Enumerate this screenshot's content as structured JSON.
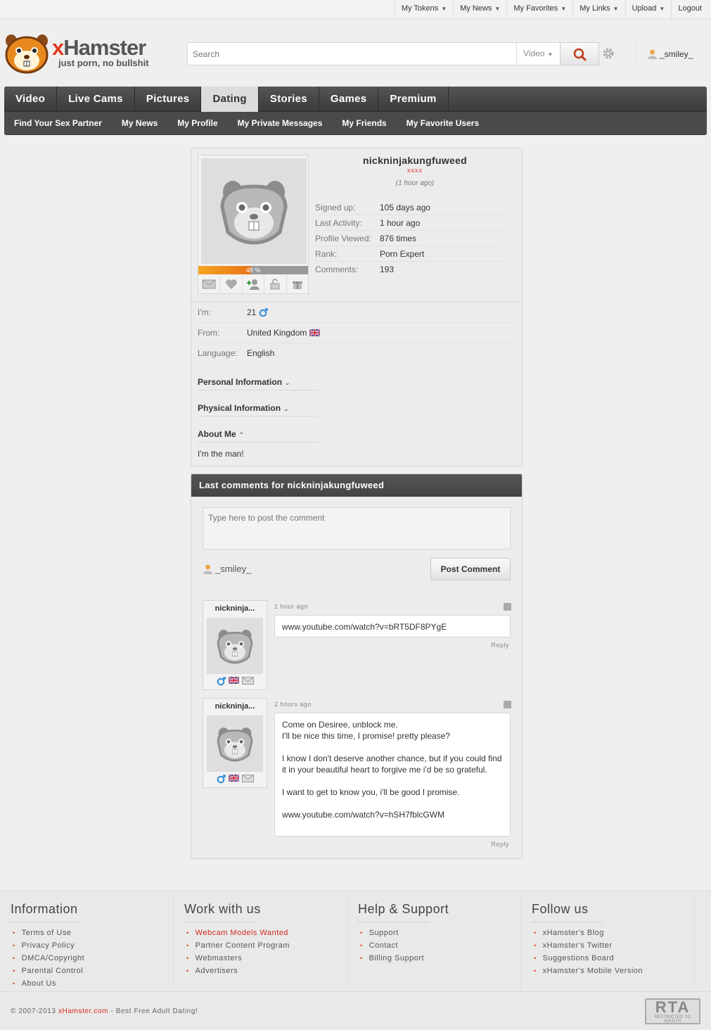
{
  "toplinks": [
    {
      "label": "My Tokens",
      "dropdown": true
    },
    {
      "label": "My News",
      "dropdown": true
    },
    {
      "label": "My Favorites",
      "dropdown": true
    },
    {
      "label": "My Links",
      "dropdown": true
    },
    {
      "label": "Upload",
      "dropdown": true
    },
    {
      "label": "Logout",
      "dropdown": false
    }
  ],
  "logo": {
    "brand_x": "x",
    "brand_rest": "Hamster",
    "tagline": "just porn, no bullshit"
  },
  "search": {
    "placeholder": "Search",
    "type": "Video"
  },
  "user": {
    "name": "_smiley_"
  },
  "nav": {
    "main": [
      "Video",
      "Live Cams",
      "Pictures",
      "Dating",
      "Stories",
      "Games",
      "Premium"
    ],
    "active": "Dating",
    "sub": [
      "Find Your Sex Partner",
      "My News",
      "My Profile",
      "My Private Messages",
      "My Friends",
      "My Favorite Users"
    ]
  },
  "profile": {
    "username": "nickninjakungfuweed",
    "marker": "xxxx",
    "last_seen": "(1 hour ago)",
    "completion": "48 %",
    "completion_value": 0.48,
    "stats": [
      {
        "label": "Signed up:",
        "value": "105 days ago"
      },
      {
        "label": "Last Activity:",
        "value": "1 hour ago"
      },
      {
        "label": "Profile Viewed:",
        "value": "876 times"
      },
      {
        "label": "Rank:",
        "value": "Porn Expert"
      },
      {
        "label": "Comments:",
        "value": "193"
      }
    ],
    "basic": [
      {
        "label": "I'm:",
        "value": "21",
        "icon": "male-icon"
      },
      {
        "label": "From:",
        "value": "United Kingdom",
        "icon": "uk-flag-icon"
      },
      {
        "label": "Language:",
        "value": "English",
        "icon": ""
      }
    ],
    "sections": {
      "personal": "Personal Information",
      "physical": "Physical Information",
      "about": "About Me"
    },
    "about_text": "I'm the man!"
  },
  "comments": {
    "title": "Last comments for nickninjakungfuweed",
    "textarea_placeholder": "Type here to post the comment",
    "user": "_smiley_",
    "post_button": "Post Comment",
    "items": [
      {
        "author": "nickninja...",
        "time": "1 hour ago",
        "text": "www.youtube.com/watch?v=bRT5DF8PYgE",
        "reply": "Reply"
      },
      {
        "author": "nickninja...",
        "time": "2 hours ago",
        "text": "Come on Desiree, unblock me.\nI'll be nice this time, I promise! pretty please?\n\nI know I don't deserve another chance, but if you could find it in your beautiful heart to forgive me i'd be so grateful.\n\nI want to get to know you, i'll be good I promise.\n\nwww.youtube.com/watch?v=hSH7fblcGWM",
        "reply": "Reply"
      }
    ]
  },
  "footer": {
    "columns": [
      {
        "title": "Information",
        "links": [
          "Terms of Use",
          "Privacy Policy",
          "DMCA/Copyright",
          "Parental Control",
          "About Us"
        ]
      },
      {
        "title": "Work with us",
        "links": [
          "Webcam Models Wanted",
          "Partner Content Program",
          "Webmasters",
          "Advertisers"
        ]
      },
      {
        "title": "Help & Support",
        "links": [
          "Support",
          "Contact",
          "Billing Support"
        ]
      },
      {
        "title": "Follow us",
        "links": [
          "xHamster's Blog",
          "xHamster's Twitter",
          "Suggestions Board",
          "xHamster's Mobile Version"
        ]
      }
    ],
    "copyright_prefix": "© 2007-2013 ",
    "copyright_brand": "xHamster.com",
    "copyright_suffix": " - Best Free Adult Dating!",
    "rta_big": "RTA",
    "rta_small": "RESTRICTED TO ADULTS"
  },
  "colors": {
    "accent_red": "#e03a1e",
    "nav_dark": "#3f3f3f",
    "progress_orange": "#e8731a"
  }
}
